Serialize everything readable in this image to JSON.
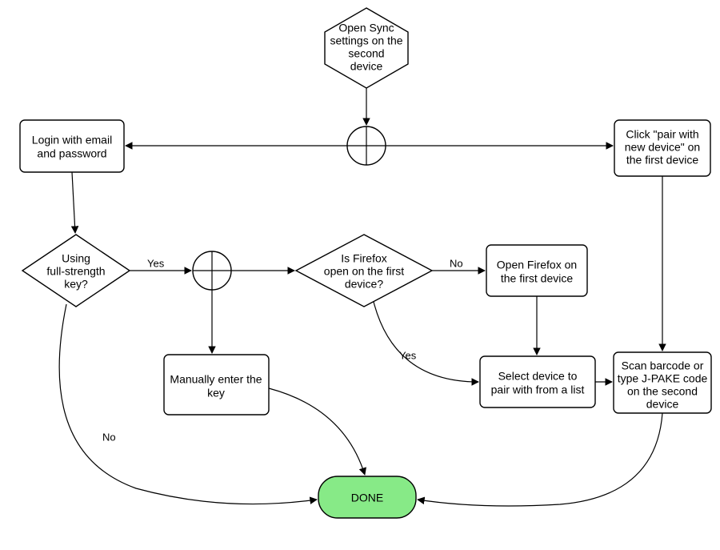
{
  "nodes": {
    "start": {
      "l1": "Open Sync",
      "l2": "settings on the",
      "l3": "second",
      "l4": "device"
    },
    "login": {
      "l1": "Login with email",
      "l2": "and password"
    },
    "pair_click": {
      "l1": "Click \"pair with",
      "l2": "new device\" on",
      "l3": "the first device"
    },
    "fullkey": {
      "l1": "Using",
      "l2": "full-strength",
      "l3": "key?"
    },
    "ffopen": {
      "l1": "Is Firefox",
      "l2": "open on the first",
      "l3": "device?"
    },
    "openff": {
      "l1": "Open Firefox on",
      "l2": "the first device"
    },
    "manual": {
      "l1": "Manually enter the",
      "l2": "key"
    },
    "selectdev": {
      "l1": "Select device to",
      "l2": "pair with from a list"
    },
    "scan": {
      "l1": "Scan barcode or",
      "l2": "type J-PAKE code",
      "l3": "on the second",
      "l4": "device"
    },
    "done": {
      "l1": "DONE"
    }
  },
  "edges": {
    "yes1": "Yes",
    "yes2": "Yes",
    "no1": "No",
    "no2": "No"
  },
  "chart_data": {
    "type": "diagram",
    "title": "",
    "nodes": [
      {
        "id": "start",
        "shape": "hexagon",
        "label": "Open Sync settings on the second device"
      },
      {
        "id": "junc1",
        "shape": "junction"
      },
      {
        "id": "login",
        "shape": "process",
        "label": "Login with email and password"
      },
      {
        "id": "pair_click",
        "shape": "process",
        "label": "Click \"pair with new device\" on the first device"
      },
      {
        "id": "fullkey",
        "shape": "decision",
        "label": "Using full-strength key?"
      },
      {
        "id": "junc2",
        "shape": "junction"
      },
      {
        "id": "ffopen",
        "shape": "decision",
        "label": "Is Firefox open on the first device?"
      },
      {
        "id": "openff",
        "shape": "process",
        "label": "Open Firefox on the first device"
      },
      {
        "id": "manual",
        "shape": "process",
        "label": "Manually enter the key"
      },
      {
        "id": "selectdev",
        "shape": "process",
        "label": "Select device to pair with from a list"
      },
      {
        "id": "scan",
        "shape": "process",
        "label": "Scan barcode or type J-PAKE code on the second device"
      },
      {
        "id": "done",
        "shape": "terminator",
        "label": "DONE",
        "fill": "#87ea87"
      }
    ],
    "edges": [
      {
        "from": "start",
        "to": "junc1"
      },
      {
        "from": "junc1",
        "to": "login"
      },
      {
        "from": "junc1",
        "to": "pair_click"
      },
      {
        "from": "login",
        "to": "fullkey"
      },
      {
        "from": "fullkey",
        "to": "junc2",
        "label": "Yes"
      },
      {
        "from": "fullkey",
        "to": "done",
        "label": "No"
      },
      {
        "from": "junc2",
        "to": "ffopen"
      },
      {
        "from": "junc2",
        "to": "manual"
      },
      {
        "from": "ffopen",
        "to": "openff",
        "label": "No"
      },
      {
        "from": "ffopen",
        "to": "selectdev",
        "label": "Yes"
      },
      {
        "from": "openff",
        "to": "selectdev"
      },
      {
        "from": "selectdev",
        "to": "scan"
      },
      {
        "from": "pair_click",
        "to": "scan"
      },
      {
        "from": "scan",
        "to": "done"
      },
      {
        "from": "manual",
        "to": "done"
      }
    ]
  }
}
